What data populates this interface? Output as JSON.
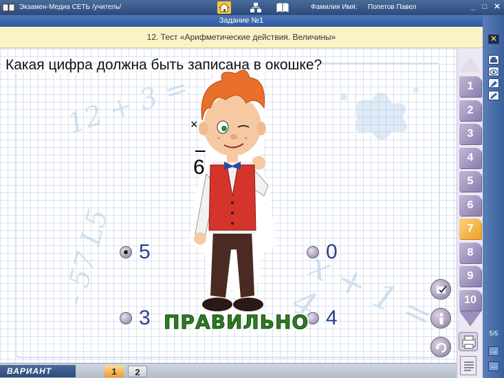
{
  "titlebar": {
    "app_title": "Экзамен-Медиа СЕТЬ /учитель/",
    "name_label": "Фамилия Имя:",
    "name_value": "Попетов Павел",
    "min": "_",
    "max": "□",
    "close": "✕"
  },
  "task": {
    "title": "Задание №1",
    "test_name": "12. Тест «Арифметические действия. Величины»"
  },
  "question": {
    "text": "Какая цифра должна быть записана в окошке?",
    "expr_sign": "×",
    "expr_result": "6"
  },
  "chalk": {
    "expr1": "12 + 3 =",
    "expr2": "- 57 L5",
    "expr3": "x + 1 = 4"
  },
  "options": [
    {
      "label": "5",
      "checked": true
    },
    {
      "label": "0",
      "checked": false
    },
    {
      "label": "3",
      "checked": false
    },
    {
      "label": "4",
      "checked": false
    }
  ],
  "feedback": "ПРАВИЛЬНО",
  "question_numbers": [
    "1",
    "2",
    "3",
    "4",
    "5",
    "6",
    "7",
    "8",
    "9",
    "10"
  ],
  "current_question": "7",
  "right_bar": {
    "close": "✕",
    "page_count": "5/5",
    "next": "→",
    "prev": "←"
  },
  "bottom": {
    "variant_label": "ВАРИАНТ",
    "variants": [
      "1",
      "2"
    ]
  },
  "icons": {
    "home": "home-icon",
    "structure": "hierarchy-icon",
    "book": "book-icon",
    "print": "printer-icon",
    "eye": "eye-icon",
    "erase": "eraser-icon",
    "pencil": "pencil-icon",
    "document": "document-icon"
  },
  "colors": {
    "accent_orange": "#f0a02a",
    "header_blue": "#2f5aa0",
    "feedback_green": "#2e7a22",
    "option_text": "#2c3f8a"
  }
}
